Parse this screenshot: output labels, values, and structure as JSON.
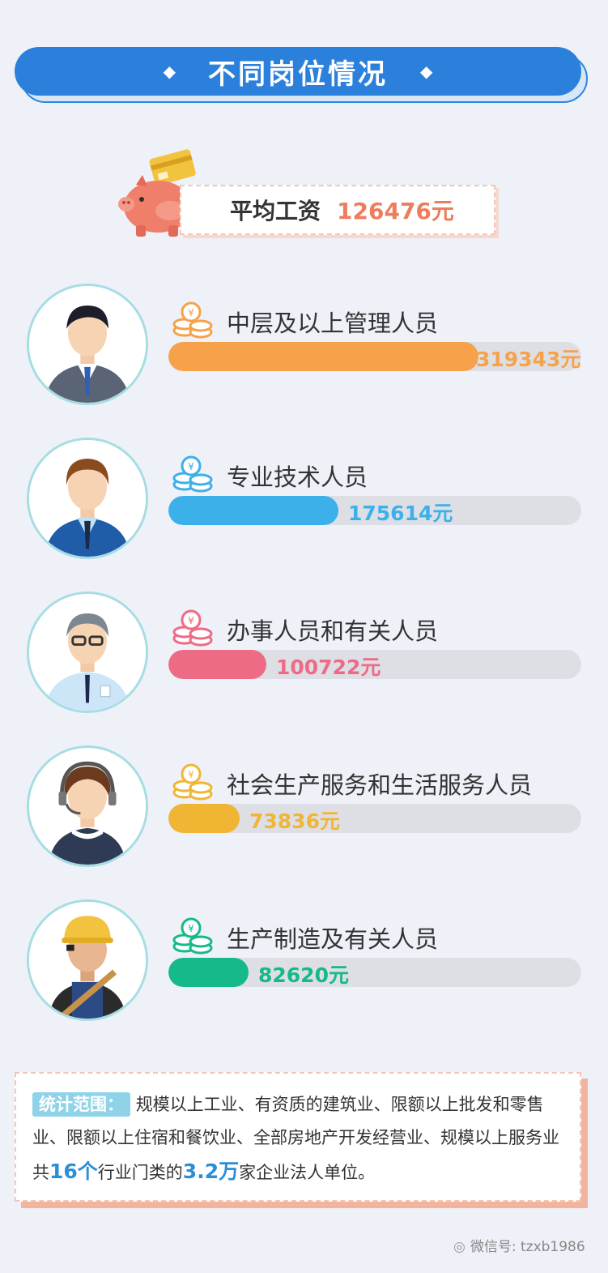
{
  "header": {
    "title": "不同岗位情况",
    "dot_left": "◆",
    "dot_right": "◆"
  },
  "average": {
    "label": "平均工资",
    "value": "126476元"
  },
  "chart_data": {
    "type": "bar",
    "orientation": "horizontal",
    "title": "",
    "categories": [
      "中层及以上管理人员",
      "专业技术人员",
      "办事人员和有关人员",
      "社会生产服务和生活服务人员",
      "生产制造及有关人员"
    ],
    "values": [
      319343,
      175614,
      100722,
      73836,
      82620
    ],
    "value_labels": [
      "319343元",
      "175614元",
      "100722元",
      "73836元",
      "82620元"
    ],
    "colors": [
      "#f6a24b",
      "#3cb0e8",
      "#ee6b86",
      "#f0b633",
      "#16b98a"
    ],
    "xlim": [
      0,
      319343
    ]
  },
  "note": {
    "tag": "统计范围：",
    "text1": "规模以上工业、有资质的建筑业、限额以上批发和零售业、限额以上住宿和餐饮业、全部房地产开发经营业、规模以上服务业共",
    "hl1": "16个",
    "text2": "行业门类的",
    "hl2": "3.2万",
    "text3": "家企业法人单位。"
  },
  "watermark": {
    "icon": "wechat-icon",
    "text": "微信号: tzxb1986"
  }
}
